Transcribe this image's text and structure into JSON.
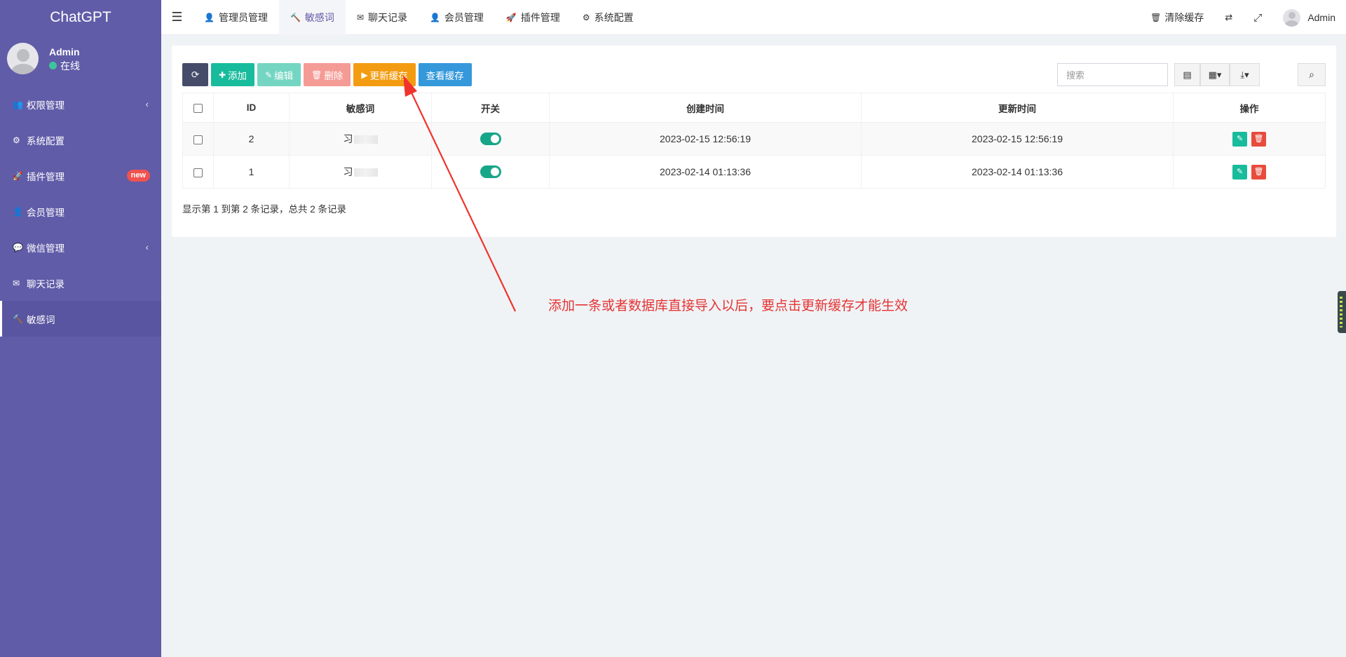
{
  "sidebar": {
    "brand": "ChatGPT",
    "user": {
      "name": "Admin",
      "status": "在线"
    },
    "items": [
      {
        "label": "权限管理",
        "icon": "users-icon",
        "glyph": "👥",
        "expand": "‹"
      },
      {
        "label": "系统配置",
        "icon": "gear-icon",
        "glyph": "⚙"
      },
      {
        "label": "插件管理",
        "icon": "rocket-icon",
        "glyph": "🚀",
        "badge": "new"
      },
      {
        "label": "会员管理",
        "icon": "user-icon",
        "glyph": "👤"
      },
      {
        "label": "微信管理",
        "icon": "wechat-icon",
        "glyph": "💬",
        "expand": "‹"
      },
      {
        "label": "聊天记录",
        "icon": "envelope-icon",
        "glyph": "✉"
      },
      {
        "label": "敏感词",
        "icon": "gavel-icon",
        "glyph": "🔨",
        "active": true
      }
    ]
  },
  "topbar": {
    "tabs": [
      {
        "label": "管理员管理",
        "glyph": "👤"
      },
      {
        "label": "敏感词",
        "glyph": "🔨",
        "active": true
      },
      {
        "label": "聊天记录",
        "glyph": "✉"
      },
      {
        "label": "会员管理",
        "glyph": "👤"
      },
      {
        "label": "插件管理",
        "glyph": "🚀"
      },
      {
        "label": "系统配置",
        "glyph": "⚙"
      }
    ],
    "clear_cache": "清除缓存",
    "admin": "Admin"
  },
  "toolbar": {
    "add": "添加",
    "edit": "编辑",
    "delete": "删除",
    "update_cache": "更新缓存",
    "view_cache": "查看缓存",
    "search_placeholder": "搜索"
  },
  "table": {
    "columns": [
      "ID",
      "敏感词",
      "开关",
      "创建时间",
      "更新时间",
      "操作"
    ],
    "rows": [
      {
        "id": "2",
        "word": "习",
        "enabled": true,
        "created": "2023-02-15 12:56:19",
        "updated": "2023-02-15 12:56:19"
      },
      {
        "id": "1",
        "word": "习",
        "enabled": true,
        "created": "2023-02-14 01:13:36",
        "updated": "2023-02-14 01:13:36"
      }
    ]
  },
  "pagination": {
    "info": "显示第 1 到第 2 条记录，总共 2 条记录"
  },
  "annotation": {
    "text": "添加一条或者数据库直接导入以后，要点击更新缓存才能生效",
    "color": "#e53333"
  },
  "colors": {
    "sidebar": "#605ca8",
    "accent": "#18bc9c",
    "warning": "#f39c12",
    "info": "#3498db",
    "danger": "#e74c3c"
  }
}
